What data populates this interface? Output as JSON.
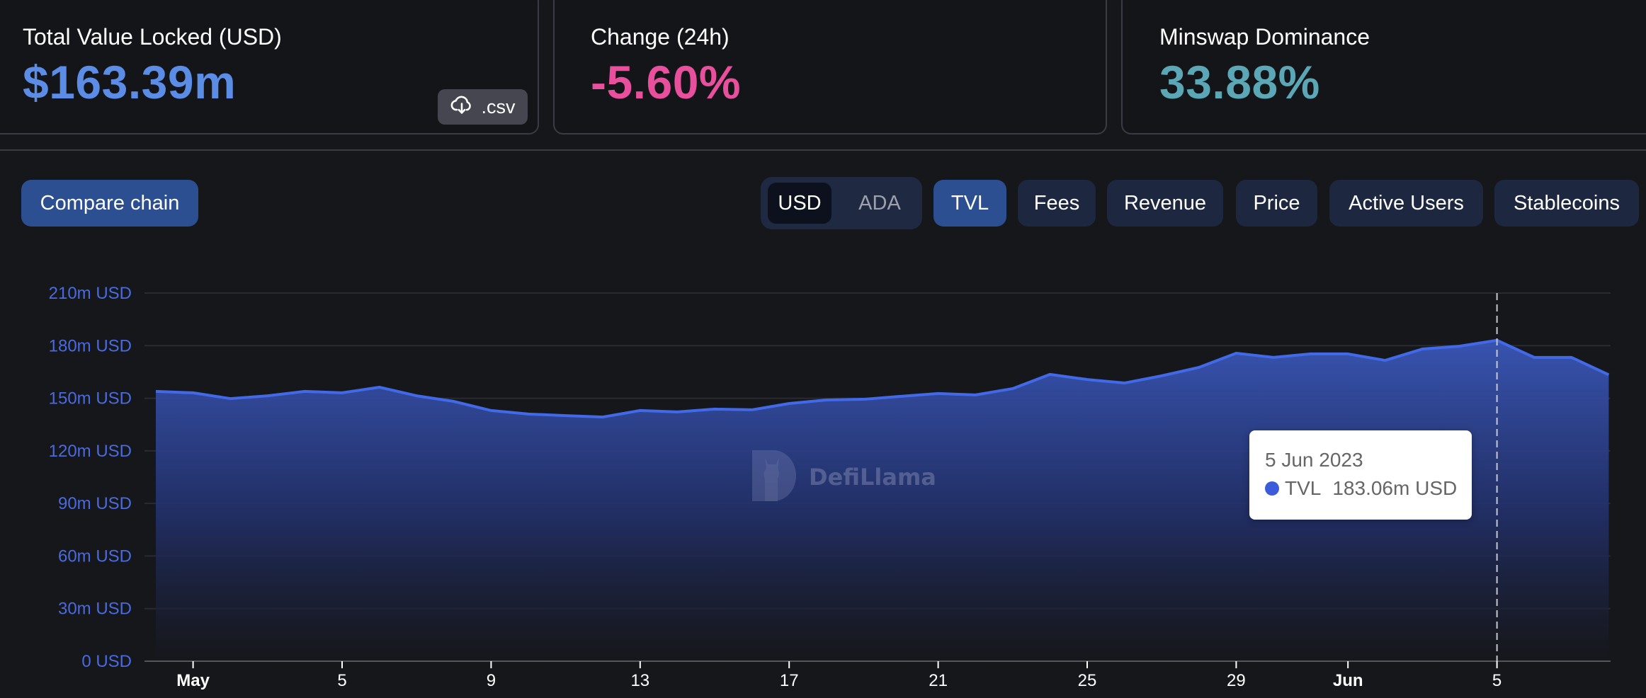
{
  "stats": {
    "tvl": {
      "label": "Total Value Locked (USD)",
      "value": "$163.39m",
      "color": "#5b8de6",
      "csv_label": ".csv",
      "csv_icon": "cloud-download-icon"
    },
    "change": {
      "label": "Change (24h)",
      "value": "-5.60%",
      "color": "#e84f9c"
    },
    "dominance": {
      "label": "Minswap Dominance",
      "value": "33.88%",
      "color": "#5ca7b6"
    }
  },
  "toolbar": {
    "compare_label": "Compare chain",
    "currency": {
      "options": [
        "USD",
        "ADA"
      ],
      "selected": "USD"
    },
    "metrics": [
      {
        "label": "TVL",
        "active": true
      },
      {
        "label": "Fees",
        "active": false
      },
      {
        "label": "Revenue",
        "active": false
      },
      {
        "label": "Price",
        "active": false
      },
      {
        "label": "Active Users",
        "active": false
      },
      {
        "label": "Stablecoins",
        "active": false
      }
    ]
  },
  "watermark": "DefiLlama",
  "tooltip": {
    "date": "5 Jun 2023",
    "series": "TVL",
    "value": "183.06m USD",
    "dot_color": "#3b5bdb"
  },
  "chart_data": {
    "type": "area",
    "title": "",
    "xlabel": "",
    "ylabel": "",
    "series": [
      {
        "name": "TVL",
        "color": "#4169e8",
        "x": [
          "2023-04-30",
          "2023-05-01",
          "2023-05-02",
          "2023-05-03",
          "2023-05-04",
          "2023-05-05",
          "2023-05-06",
          "2023-05-07",
          "2023-05-08",
          "2023-05-09",
          "2023-05-10",
          "2023-05-11",
          "2023-05-12",
          "2023-05-13",
          "2023-05-14",
          "2023-05-15",
          "2023-05-16",
          "2023-05-17",
          "2023-05-18",
          "2023-05-19",
          "2023-05-20",
          "2023-05-21",
          "2023-05-22",
          "2023-05-23",
          "2023-05-24",
          "2023-05-25",
          "2023-05-26",
          "2023-05-27",
          "2023-05-28",
          "2023-05-29",
          "2023-05-30",
          "2023-05-31",
          "2023-06-01",
          "2023-06-02",
          "2023-06-03",
          "2023-06-04",
          "2023-06-05",
          "2023-06-06",
          "2023-06-07",
          "2023-06-08"
        ],
        "values": [
          153.9,
          153.1,
          149.8,
          151.4,
          153.9,
          153.1,
          156.3,
          151.4,
          148.2,
          143.0,
          141.0,
          140.1,
          139.3,
          143.0,
          142.2,
          143.8,
          143.4,
          147.0,
          149.0,
          149.4,
          151.1,
          152.7,
          151.9,
          155.5,
          163.6,
          160.7,
          158.7,
          162.8,
          167.6,
          175.7,
          173.3,
          175.3,
          175.3,
          171.6,
          178.1,
          179.7,
          183.06,
          173.3,
          173.3,
          163.4
        ]
      }
    ],
    "y_unit": "m USD",
    "ylim": [
      0,
      210
    ],
    "y_ticks": [
      0,
      30,
      60,
      90,
      120,
      150,
      180,
      210
    ],
    "y_tick_labels": [
      "0 USD",
      "30m USD",
      "60m USD",
      "90m USD",
      "120m USD",
      "150m USD",
      "180m USD",
      "210m USD"
    ],
    "x_ticks": [
      {
        "date": "2023-05-01",
        "label": "May",
        "month": true
      },
      {
        "date": "2023-05-05",
        "label": "5",
        "month": false
      },
      {
        "date": "2023-05-09",
        "label": "9",
        "month": false
      },
      {
        "date": "2023-05-13",
        "label": "13",
        "month": false
      },
      {
        "date": "2023-05-17",
        "label": "17",
        "month": false
      },
      {
        "date": "2023-05-21",
        "label": "21",
        "month": false
      },
      {
        "date": "2023-05-25",
        "label": "25",
        "month": false
      },
      {
        "date": "2023-05-29",
        "label": "29",
        "month": false
      },
      {
        "date": "2023-06-01",
        "label": "Jun",
        "month": true
      },
      {
        "date": "2023-06-05",
        "label": "5",
        "month": false
      }
    ],
    "hover_date": "2023-06-05",
    "grid": true,
    "legend": "none"
  }
}
